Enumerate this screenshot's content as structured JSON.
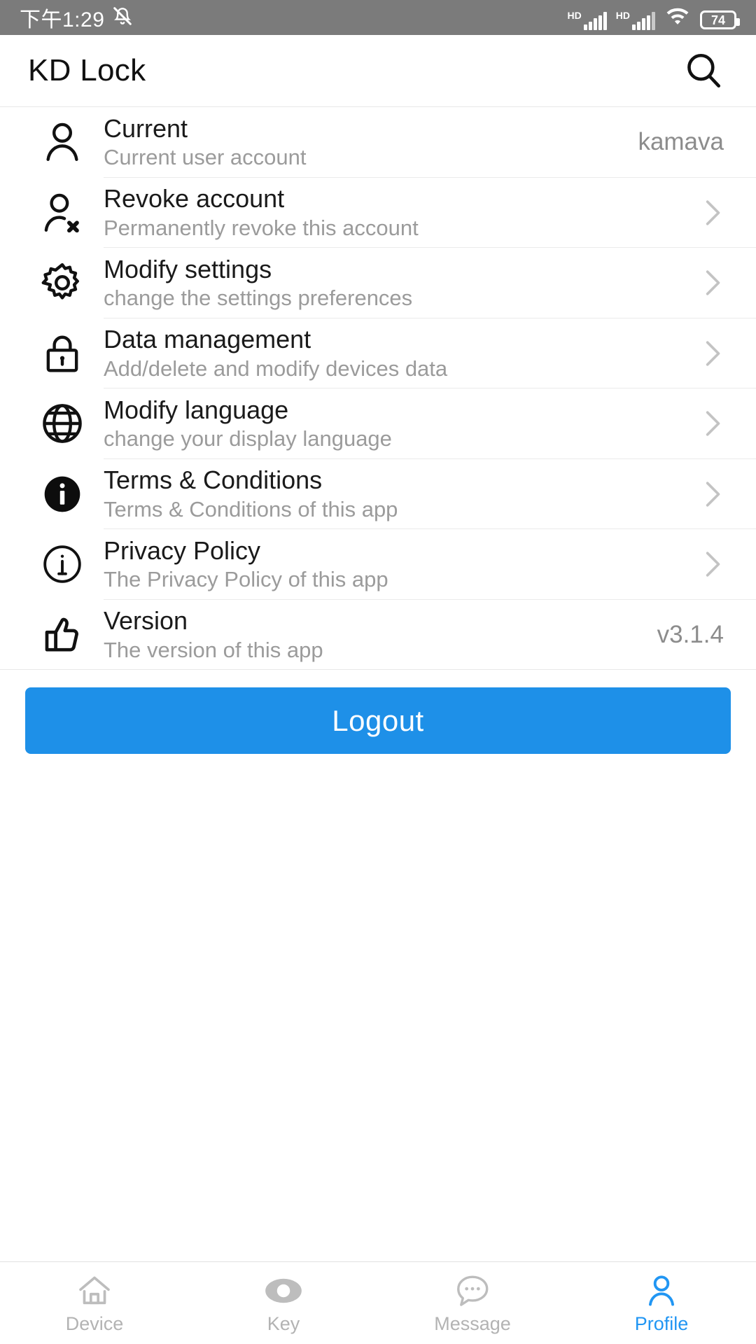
{
  "status_bar": {
    "time": "下午1:29",
    "mute_icon": "bell-muted-icon",
    "signal_label_1": "HD",
    "signal_label_2": "HD",
    "wifi_icon": "wifi-icon",
    "battery_percent": "74"
  },
  "header": {
    "title": "KD Lock",
    "search_icon": "search-icon"
  },
  "list": {
    "items": [
      {
        "icon": "person-icon",
        "title": "Current",
        "subtitle": "Current user account",
        "value": "kamava",
        "chevron": false
      },
      {
        "icon": "person-remove-icon",
        "title": "Revoke account",
        "subtitle": "Permanently revoke this account",
        "value": "",
        "chevron": true
      },
      {
        "icon": "gear-icon",
        "title": "Modify settings",
        "subtitle": "change the settings preferences",
        "value": "",
        "chevron": true
      },
      {
        "icon": "lock-icon",
        "title": "Data management",
        "subtitle": "Add/delete and modify devices data",
        "value": "",
        "chevron": true
      },
      {
        "icon": "globe-icon",
        "title": "Modify language",
        "subtitle": "change your display language",
        "value": "",
        "chevron": true
      },
      {
        "icon": "info-filled-icon",
        "title": "Terms & Conditions",
        "subtitle": "Terms & Conditions of this app",
        "value": "",
        "chevron": true
      },
      {
        "icon": "info-outline-icon",
        "title": "Privacy Policy",
        "subtitle": "The Privacy Policy of this app",
        "value": "",
        "chevron": true
      },
      {
        "icon": "thumbs-up-icon",
        "title": "Version",
        "subtitle": "The version of this app",
        "value": "v3.1.4",
        "chevron": false
      }
    ]
  },
  "logout": {
    "label": "Logout",
    "color": "#1e90e8"
  },
  "bottom_nav": {
    "active_color": "#2196f3",
    "inactive_color": "#b3b3b3",
    "items": [
      {
        "icon": "home-icon",
        "label": "Device",
        "active": false
      },
      {
        "icon": "eye-icon",
        "label": "Key",
        "active": false
      },
      {
        "icon": "message-icon",
        "label": "Message",
        "active": false
      },
      {
        "icon": "person-icon",
        "label": "Profile",
        "active": true
      }
    ]
  }
}
